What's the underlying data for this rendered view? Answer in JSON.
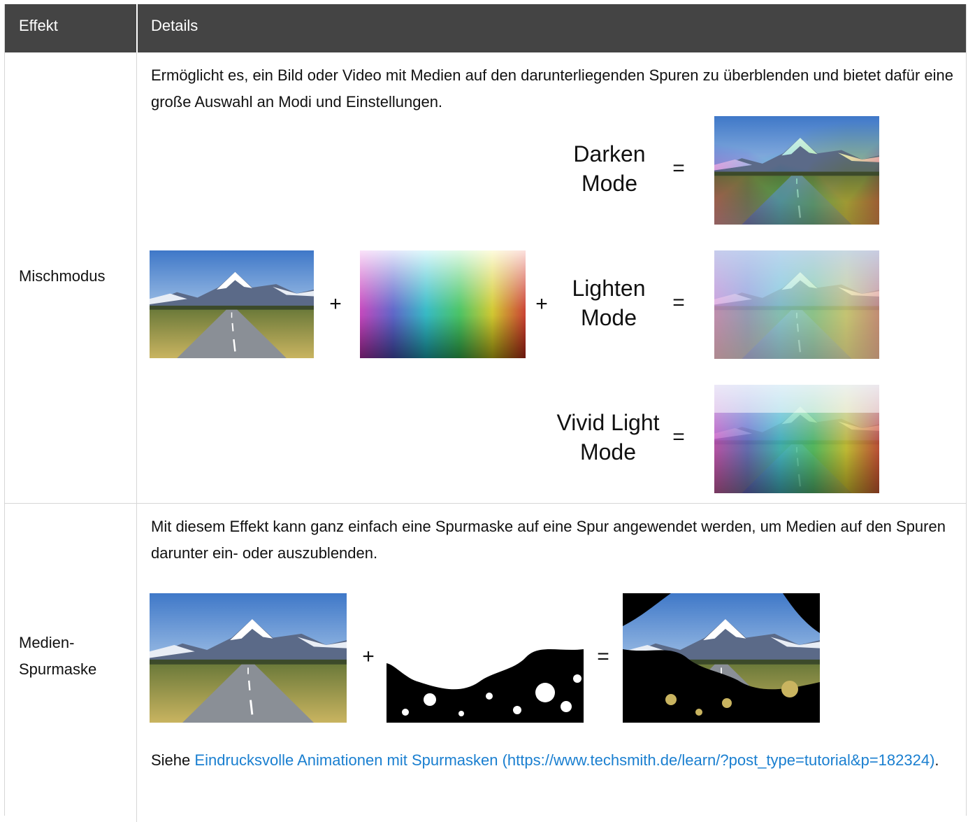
{
  "table": {
    "headers": [
      "Effekt",
      "Details"
    ],
    "rows": [
      {
        "effect": "Mischmodus",
        "description": "Ermöglicht es, ein Bild oder Video mit Medien auf den darunterliegenden Spuren zu überblenden und bietet dafür eine große Auswahl an Modi und Einstellungen.",
        "figure": {
          "plus": "+",
          "equals": "=",
          "modes": [
            {
              "line1": "Darken",
              "line2": "Mode"
            },
            {
              "line1": "Lighten",
              "line2": "Mode"
            },
            {
              "line1": "Vivid Light",
              "line2": "Mode"
            }
          ]
        }
      },
      {
        "effect": "Medien-Spurmaske",
        "effect_line1": "Medien-",
        "effect_line2": "Spurmaske",
        "description": "Mit diesem Effekt kann ganz einfach eine Spurmaske auf eine Spur angewendet werden, um Medien auf den Spuren darunter ein- oder auszublenden.",
        "figure": {
          "plus": "+",
          "equals": "="
        },
        "see_prefix": "Siehe ",
        "link_text": "Eindrucksvolle Animationen mit Spurmasken (https://www.techsmith.de/learn/?post_type=tutorial&p=182324)",
        "see_suffix": "."
      }
    ]
  }
}
